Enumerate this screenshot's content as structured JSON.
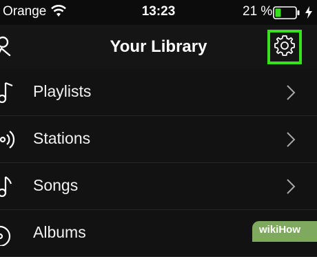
{
  "status_bar": {
    "carrier": "Orange",
    "time": "13:23",
    "battery_percent": "21 %"
  },
  "nav_bar": {
    "title": "Your Library",
    "highlight_color": "#39e01e"
  },
  "library_items": [
    {
      "label": "Playlists",
      "icon": "music-note-icon"
    },
    {
      "label": "Stations",
      "icon": "radio-icon"
    },
    {
      "label": "Songs",
      "icon": "music-note-icon"
    },
    {
      "label": "Albums",
      "icon": "album-icon"
    }
  ],
  "watermark": {
    "text": "wikiHow"
  },
  "colors": {
    "background": "#121212",
    "text": "#ffffff",
    "accent": "#39e01e"
  }
}
